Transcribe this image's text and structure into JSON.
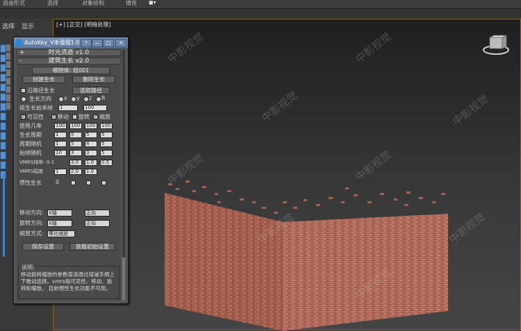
{
  "menu": {
    "top_items": [
      "自由形式",
      "选择",
      "对象绘制",
      "填充"
    ],
    "left_tabs": [
      "选择",
      "显示"
    ]
  },
  "viewport": {
    "label": "[+] [正交] [明暗处理]"
  },
  "watermark": "中影视觉",
  "panel": {
    "title": "AutoKey_V本强强1.0",
    "title_buttons": [
      "?",
      "—",
      "□",
      "✕"
    ],
    "section1": "时光流逝 v1.0",
    "section2": "建筑生长 v2.0",
    "group_label": "细物体:  组001",
    "create_btn": "创建生长",
    "delete_btn": "删除生长",
    "path_chk": "沿路径生长",
    "pick_path_btn": "选取路径",
    "dir_label": "生长方向",
    "dir_opts": [
      "x",
      "y",
      "z",
      "R"
    ],
    "group_start": "组生长始末帧",
    "start_val": "1",
    "end_val": "100",
    "vis_chk": "可见性",
    "move_chk": "移动",
    "rot_chk": "旋转",
    "scale_chk": "缩放",
    "usage_label": "使用几率",
    "usage_vals": [
      "100",
      "100",
      "100",
      "100"
    ],
    "cycle_label": "生长周期",
    "cycle_vals": [
      "1",
      "5",
      "5",
      "5"
    ],
    "cycle_rand_label": "周期随机",
    "cycle_rand_vals": [
      "1",
      "5",
      "4",
      "5"
    ],
    "start_rand_label": "始帧随机",
    "start_rand_vals": [
      "10",
      "3",
      "3",
      "5"
    ],
    "vmrs_sort_label": "VMRS排序: 0-1",
    "vmrs_sort_vals": [
      "3.0",
      "1.0",
      "0.5"
    ],
    "vmrs_amp_label": "VMRS幅度",
    "vmrs_amp_vals": [
      "1",
      "2.0",
      "1.0"
    ],
    "inertia_label": "惯性生长",
    "inertia_val": "0",
    "move_dir_label": "移动方向:",
    "move_dir_val": "X轴",
    "move_dir_val2": "正向",
    "rot_dir_label": "旋转方向:",
    "rot_dir_val": "X轴",
    "rot_dir_val2": "正向",
    "scale_mode_label": "缩放方式:",
    "scale_mode_val": "等比缩放",
    "save_btn": "保存设置",
    "load_btn": "装载初始设置",
    "note_title": "说明:",
    "note_text": "移动旋转缩放的参数值请通过增减手柄上下推动选择。vmrs指可见性、移动、旋转和缩放。     目前惯性生长功能不可用。"
  }
}
